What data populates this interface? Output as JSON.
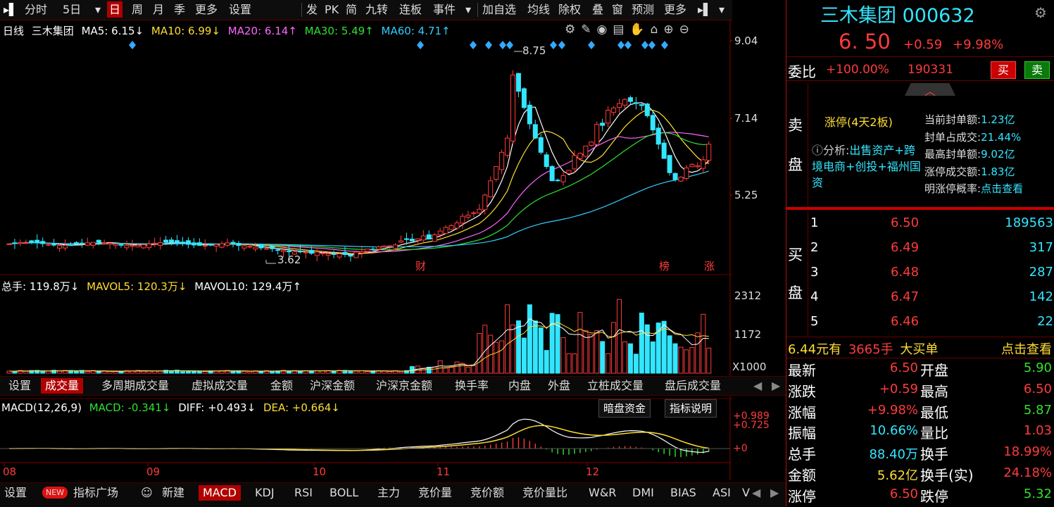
{
  "toolbar": {
    "items": [
      "分时",
      "5日",
      "日",
      "周",
      "月",
      "季",
      "更多",
      "设置",
      "发",
      "PK",
      "简",
      "九转",
      "连板",
      "事件",
      "加自选",
      "均线",
      "除权",
      "叠",
      "窗",
      "预测",
      "更多"
    ],
    "active": "日"
  },
  "main_legend": {
    "period": "日线",
    "name": "三木集团",
    "ma5": "MA5: 6.15↓",
    "ma10": "MA10: 6.99↓",
    "ma20": "MA20: 6.14↑",
    "ma30": "MA30: 5.49↑",
    "ma60": "MA60: 4.71↑"
  },
  "price_axis": [
    "9.04",
    "7.14",
    "5.25"
  ],
  "annotations": {
    "high": "8.75",
    "low": "3.62",
    "cai": "财",
    "bang": "榜",
    "zhang": "涨"
  },
  "vol_legend": {
    "total": "总手: 119.8万↓",
    "mavol5": "MAVOL5: 120.3万↓",
    "mavol10": "MAVOL10: 129.4万↑"
  },
  "vol_axis": [
    "2312",
    "1172",
    "X1000"
  ],
  "tabs1": [
    "设置",
    "成交量",
    "多周期成交量",
    "虚拟成交量",
    "金额",
    "沪深金额",
    "沪深京金额",
    "换手率",
    "内盘",
    "外盘",
    "立桩成交量",
    "盘后成交量"
  ],
  "tabs1_active": "成交量",
  "macd_legend": {
    "title": "MACD(12,26,9)",
    "macd": "MACD: -0.341↓",
    "diff": "DIFF: +0.493↓",
    "dea": "DEA: +0.664↓"
  },
  "macd_buttons": [
    "暗盘资金",
    "指标说明"
  ],
  "macd_axis": [
    "+0.989",
    "+0.725",
    "+0"
  ],
  "months": [
    "08",
    "09",
    "10",
    "11",
    "12"
  ],
  "tabs2": [
    "设置",
    "NEW",
    "指标广场",
    "新建",
    "MACD",
    "KDJ",
    "RSI",
    "BOLL",
    "主力",
    "竞价量",
    "竞价额",
    "竞价量比",
    "W&R",
    "DMI",
    "BIAS",
    "ASI",
    "V"
  ],
  "tabs2_active": "MACD",
  "quote": {
    "name": "三木集团",
    "code": "000632",
    "price": "6. 50",
    "change": "+0.59",
    "pct": "+9.98%",
    "weibi_label": "委比",
    "weibi": "+100.00%",
    "weicha": "190331",
    "buy_btn": "买",
    "sell_btn": "卖",
    "sell_panel_label1": "卖",
    "sell_panel_label2": "盘",
    "limit_title": "涨停(4天2板)",
    "analysis_label": "分析:",
    "analysis_text": "出售资产+跨境电商+创投+福州国资",
    "stats": [
      {
        "k": "当前封单额:",
        "v": "1.23亿"
      },
      {
        "k": "封单占成交:",
        "v": "21.44%"
      },
      {
        "k": "最高封单额:",
        "v": "9.02亿"
      },
      {
        "k": "涨停成交额:",
        "v": "1.83亿"
      },
      {
        "k": "明涨停概率:",
        "v": "点击查看"
      }
    ],
    "buy_label1": "买",
    "buy_label2": "盘",
    "bids": [
      {
        "n": "1",
        "p": "6.50",
        "v": "189563"
      },
      {
        "n": "2",
        "p": "6.49",
        "v": "317"
      },
      {
        "n": "3",
        "p": "6.48",
        "v": "287"
      },
      {
        "n": "4",
        "p": "6.47",
        "v": "142"
      },
      {
        "n": "5",
        "p": "6.46",
        "v": "22"
      }
    ],
    "bigorder": {
      "price": "6.44",
      "unit": "元有",
      "qty": "3665手",
      "label": "大买单",
      "link": "点击查看"
    },
    "detail": [
      {
        "k1": "最新",
        "v1": "6.50",
        "k2": "开盘",
        "v2": "5.90"
      },
      {
        "k1": "涨跌",
        "v1": "+0.59",
        "k2": "最高",
        "v2": "6.50"
      },
      {
        "k1": "涨幅",
        "v1": "+9.98%",
        "k2": "最低",
        "v2": "5.87"
      },
      {
        "k1": "振幅",
        "v1": "10.66%",
        "k2": "量比",
        "v2": "1.03"
      },
      {
        "k1": "总手",
        "v1": "88.40万",
        "k2": "换手",
        "v2": "18.99%"
      },
      {
        "k1": "金额",
        "v1": "5.62亿",
        "k2": "换手(实)",
        "v2": "24.18%"
      },
      {
        "k1": "涨停",
        "v1": "6.50",
        "k2": "跌停",
        "v2": "5.32"
      }
    ]
  },
  "colors": {
    "up": "#ff3b3b",
    "down": "#33e6ff",
    "ma5": "#ffffff",
    "ma10": "#ffdd33",
    "ma20": "#ff66ff",
    "ma30": "#30e030",
    "ma60": "#33ccff"
  }
}
